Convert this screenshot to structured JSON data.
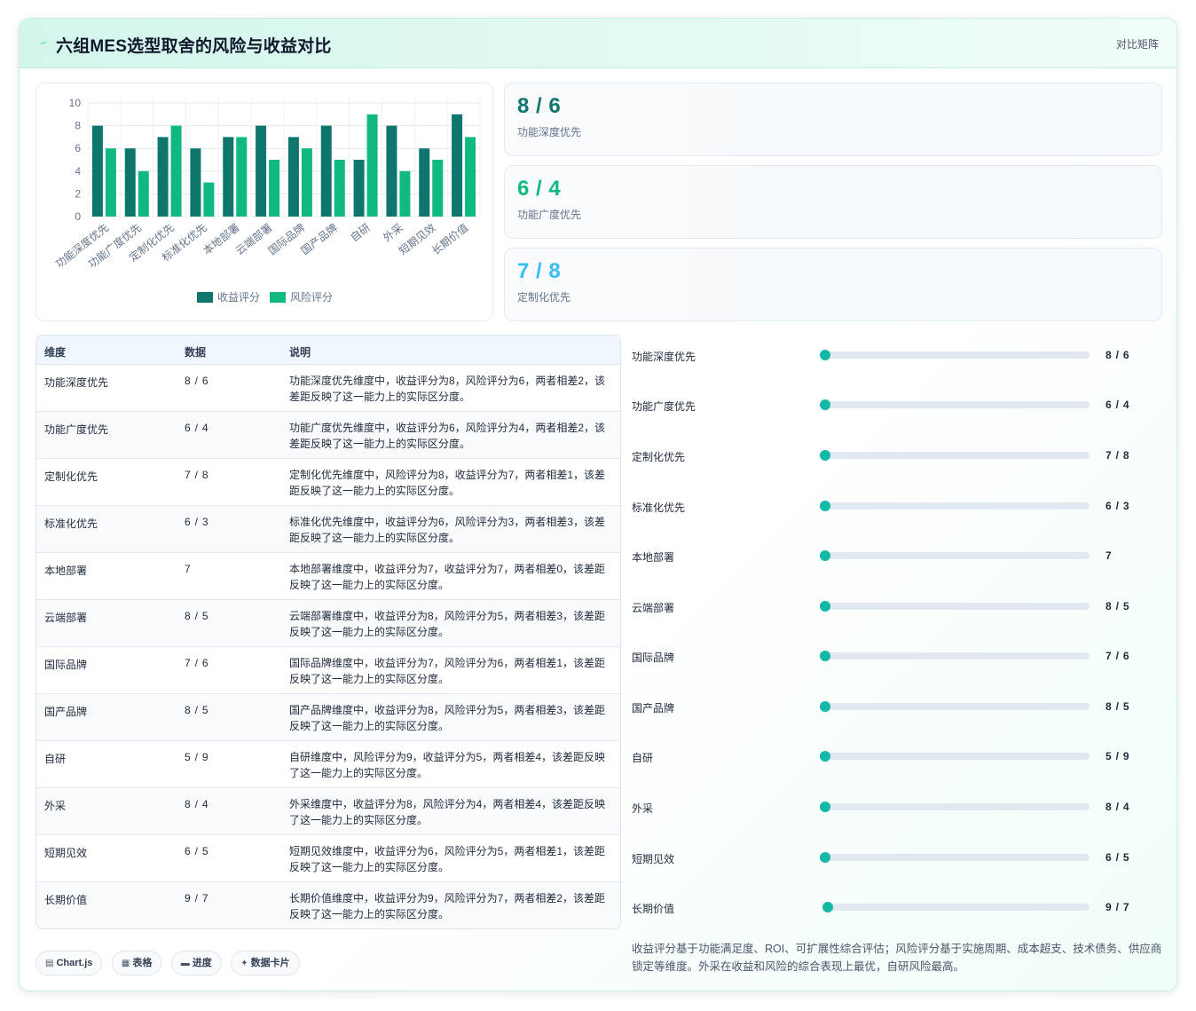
{
  "header": {
    "title": "六组MES选型取舍的风险与收益对比",
    "link": "对比矩阵",
    "icon": "lightning-icon"
  },
  "colors": {
    "gain": "#0f766e",
    "risk": "#10b981",
    "accent": "#14b8a6",
    "kpi1": "#0f766e",
    "kpi2": "#10b981",
    "kpi3": "#38bdf8"
  },
  "chart_data": {
    "type": "bar",
    "categories": [
      "功能深度优先",
      "功能广度优先",
      "定制化优先",
      "标准化优先",
      "本地部署",
      "云端部署",
      "国际品牌",
      "国产品牌",
      "自研",
      "外采",
      "短期见效",
      "长期价值"
    ],
    "series": [
      {
        "name": "收益评分",
        "values": [
          8,
          6,
          7,
          6,
          7,
          8,
          7,
          8,
          5,
          8,
          6,
          9
        ]
      },
      {
        "name": "风险评分",
        "values": [
          6,
          4,
          8,
          3,
          7,
          5,
          6,
          5,
          9,
          4,
          5,
          7
        ]
      }
    ],
    "ylim": [
      0,
      10
    ],
    "yticks": [
      "10",
      "8",
      "6",
      "4",
      "2",
      "0"
    ],
    "grid": true,
    "legend": "bottom"
  },
  "kpis": [
    {
      "value": "8 / 6",
      "label": "功能深度优先"
    },
    {
      "value": "6 / 4",
      "label": "功能广度优先"
    },
    {
      "value": "7 / 8",
      "label": "定制化优先"
    }
  ],
  "table": {
    "headers": [
      "维度",
      "数据",
      "说明"
    ],
    "rows": [
      {
        "dim": "功能深度优先",
        "val": "8 / 6",
        "desc": "功能深度优先维度中，收益评分为8，风险评分为6，两者相差2，该差距反映了这一能力上的实际区分度。"
      },
      {
        "dim": "功能广度优先",
        "val": "6 / 4",
        "desc": "功能广度优先维度中，收益评分为6，风险评分为4，两者相差2，该差距反映了这一能力上的实际区分度。"
      },
      {
        "dim": "定制化优先",
        "val": "7 / 8",
        "desc": "定制化优先维度中，风险评分为8，收益评分为7，两者相差1，该差距反映了这一能力上的实际区分度。"
      },
      {
        "dim": "标准化优先",
        "val": "6 / 3",
        "desc": "标准化优先维度中，收益评分为6，风险评分为3，两者相差3，该差距反映了这一能力上的实际区分度。"
      },
      {
        "dim": "本地部署",
        "val": "7",
        "desc": "本地部署维度中，收益评分为7，收益评分为7，两者相差0，该差距反映了这一能力上的实际区分度。"
      },
      {
        "dim": "云端部署",
        "val": "8 / 5",
        "desc": "云端部署维度中，收益评分为8，风险评分为5，两者相差3，该差距反映了这一能力上的实际区分度。"
      },
      {
        "dim": "国际品牌",
        "val": "7 / 6",
        "desc": "国际品牌维度中，收益评分为7，风险评分为6，两者相差1，该差距反映了这一能力上的实际区分度。"
      },
      {
        "dim": "国产品牌",
        "val": "8 / 5",
        "desc": "国产品牌维度中，收益评分为8，风险评分为5，两者相差3，该差距反映了这一能力上的实际区分度。"
      },
      {
        "dim": "自研",
        "val": "5 / 9",
        "desc": "自研维度中，风险评分为9，收益评分为5，两者相差4，该差距反映了这一能力上的实际区分度。"
      },
      {
        "dim": "外采",
        "val": "8 / 4",
        "desc": "外采维度中，收益评分为8，风险评分为4，两者相差4，该差距反映了这一能力上的实际区分度。"
      },
      {
        "dim": "短期见效",
        "val": "6 / 5",
        "desc": "短期见效维度中，收益评分为6，风险评分为5，两者相差1，该差距反映了这一能力上的实际区分度。"
      },
      {
        "dim": "长期价值",
        "val": "9 / 7",
        "desc": "长期价值维度中，收益评分为9，风险评分为7，两者相差2，该差距反映了这一能力上的实际区分度。"
      }
    ]
  },
  "chips": [
    {
      "icon": "chart-icon",
      "label": "Chart.js"
    },
    {
      "icon": "table-icon",
      "label": "表格"
    },
    {
      "icon": "progress-icon",
      "label": "进度"
    },
    {
      "icon": "card-icon",
      "label": "数据卡片"
    }
  ],
  "progress": [
    {
      "label": "功能深度优先",
      "value": "8 / 6",
      "level": 0
    },
    {
      "label": "功能广度优先",
      "value": "6 / 4",
      "level": 0
    },
    {
      "label": "定制化优先",
      "value": "7 / 8",
      "level": 0
    },
    {
      "label": "标准化优先",
      "value": "6 / 3",
      "level": 0
    },
    {
      "label": "本地部署",
      "value": "7",
      "level": 0
    },
    {
      "label": "云端部署",
      "value": "8 / 5",
      "level": 0
    },
    {
      "label": "国际品牌",
      "value": "7 / 6",
      "level": 0
    },
    {
      "label": "国产品牌",
      "value": "8 / 5",
      "level": 0
    },
    {
      "label": "自研",
      "value": "5 / 9",
      "level": 0
    },
    {
      "label": "外采",
      "value": "8 / 4",
      "level": 0
    },
    {
      "label": "短期见效",
      "value": "6 / 5",
      "level": 0
    },
    {
      "label": "长期价值",
      "value": "9 / 7",
      "level": 0.01
    }
  ],
  "footnote": "收益评分基于功能满足度、ROI、可扩展性综合评估；风险评分基于实施周期、成本超支、技术债务、供应商锁定等维度。外采在收益和风险的综合表现上最优，自研风险最高。"
}
